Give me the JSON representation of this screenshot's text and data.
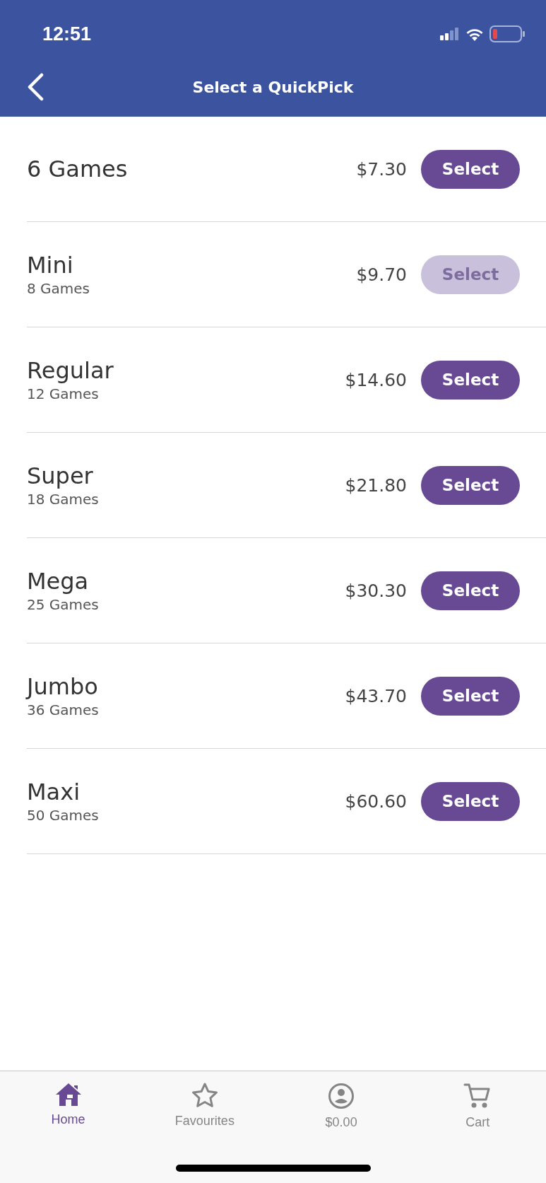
{
  "status_bar": {
    "time": "12:51"
  },
  "header": {
    "title": "Select a QuickPick"
  },
  "options": [
    {
      "name": "6 Games",
      "price": "$7.30",
      "button": "Select",
      "disabled": false
    },
    {
      "name": "Mini",
      "games": "8 Games",
      "price": "$9.70",
      "button": "Select",
      "disabled": true
    },
    {
      "name": "Regular",
      "games": "12 Games",
      "price": "$14.60",
      "button": "Select",
      "disabled": false
    },
    {
      "name": "Super",
      "games": "18 Games",
      "price": "$21.80",
      "button": "Select",
      "disabled": false
    },
    {
      "name": "Mega",
      "games": "25 Games",
      "price": "$30.30",
      "button": "Select",
      "disabled": false
    },
    {
      "name": "Jumbo",
      "games": "36 Games",
      "price": "$43.70",
      "button": "Select",
      "disabled": false
    },
    {
      "name": "Maxi",
      "games": "50 Games",
      "price": "$60.60",
      "button": "Select",
      "disabled": false
    }
  ],
  "tab_bar": [
    {
      "label": "Home",
      "kind": "home",
      "selected": true
    },
    {
      "label": "Favourites",
      "kind": "favourites",
      "selected": false
    },
    {
      "label": "$0.00",
      "kind": "account",
      "selected": false
    },
    {
      "label": "Cart",
      "kind": "cart",
      "selected": false
    }
  ]
}
